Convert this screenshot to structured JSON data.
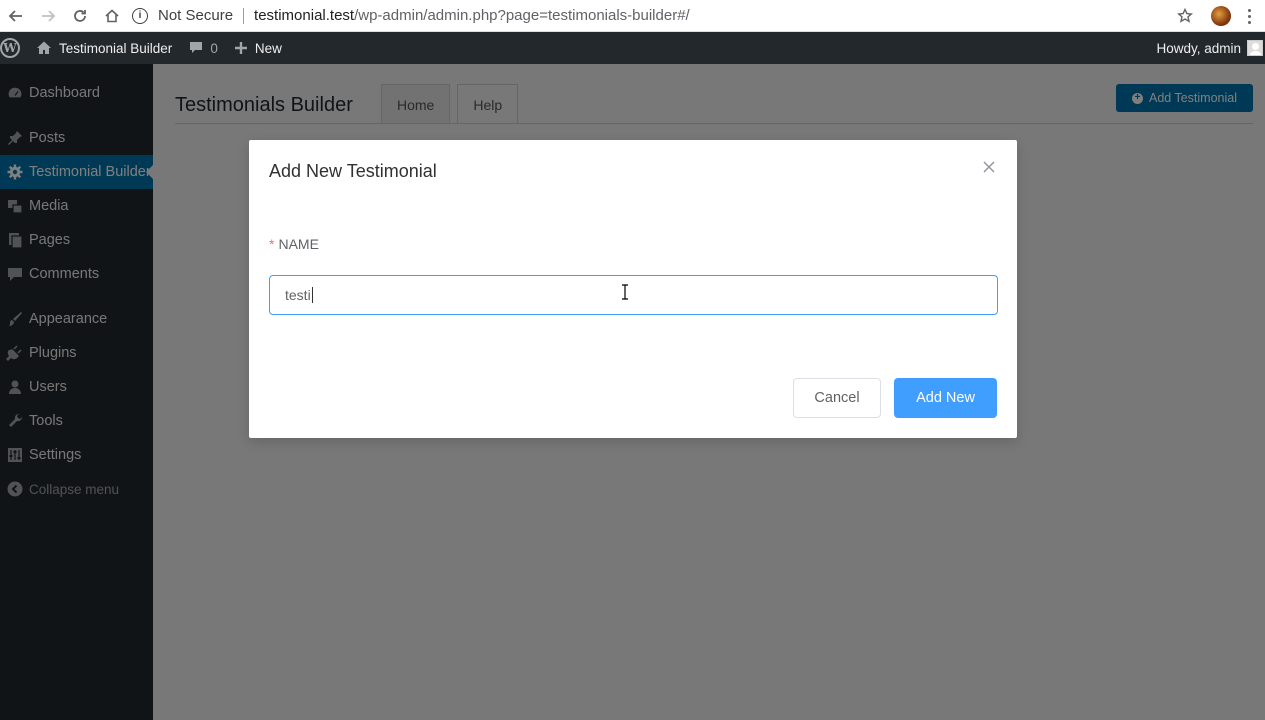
{
  "browser": {
    "security_label": "Not Secure",
    "url_host": "testimonial.test",
    "url_path": "/wp-admin/admin.php?page=testimonials-builder#/"
  },
  "adminbar": {
    "site_name": "Testimonial Builder",
    "comments_count": "0",
    "new_label": "New",
    "howdy": "Howdy, admin"
  },
  "sidebar": {
    "items": [
      {
        "label": "Dashboard",
        "icon": "dashboard-icon"
      },
      {
        "label": "Posts",
        "icon": "pin-icon"
      },
      {
        "label": "Testimonial Builder",
        "icon": "gear-icon",
        "current": true
      },
      {
        "label": "Media",
        "icon": "media-icon"
      },
      {
        "label": "Pages",
        "icon": "pages-icon"
      },
      {
        "label": "Comments",
        "icon": "comment-icon"
      },
      {
        "label": "Appearance",
        "icon": "brush-icon"
      },
      {
        "label": "Plugins",
        "icon": "plug-icon"
      },
      {
        "label": "Users",
        "icon": "user-icon"
      },
      {
        "label": "Tools",
        "icon": "wrench-icon"
      },
      {
        "label": "Settings",
        "icon": "settings-icon"
      }
    ],
    "collapse_label": "Collapse menu"
  },
  "main": {
    "title": "Testimonials Builder",
    "tabs": [
      {
        "label": "Home"
      },
      {
        "label": "Help"
      }
    ],
    "add_button_label": "Add Testimonial"
  },
  "modal": {
    "title": "Add New Testimonial",
    "field_label": "NAME",
    "field_value": "testi",
    "cancel_label": "Cancel",
    "submit_label": "Add New"
  },
  "colors": {
    "wp_dark": "#23282d",
    "wp_blue": "#0073aa",
    "primary": "#409eff",
    "required": "#f56c6c"
  }
}
